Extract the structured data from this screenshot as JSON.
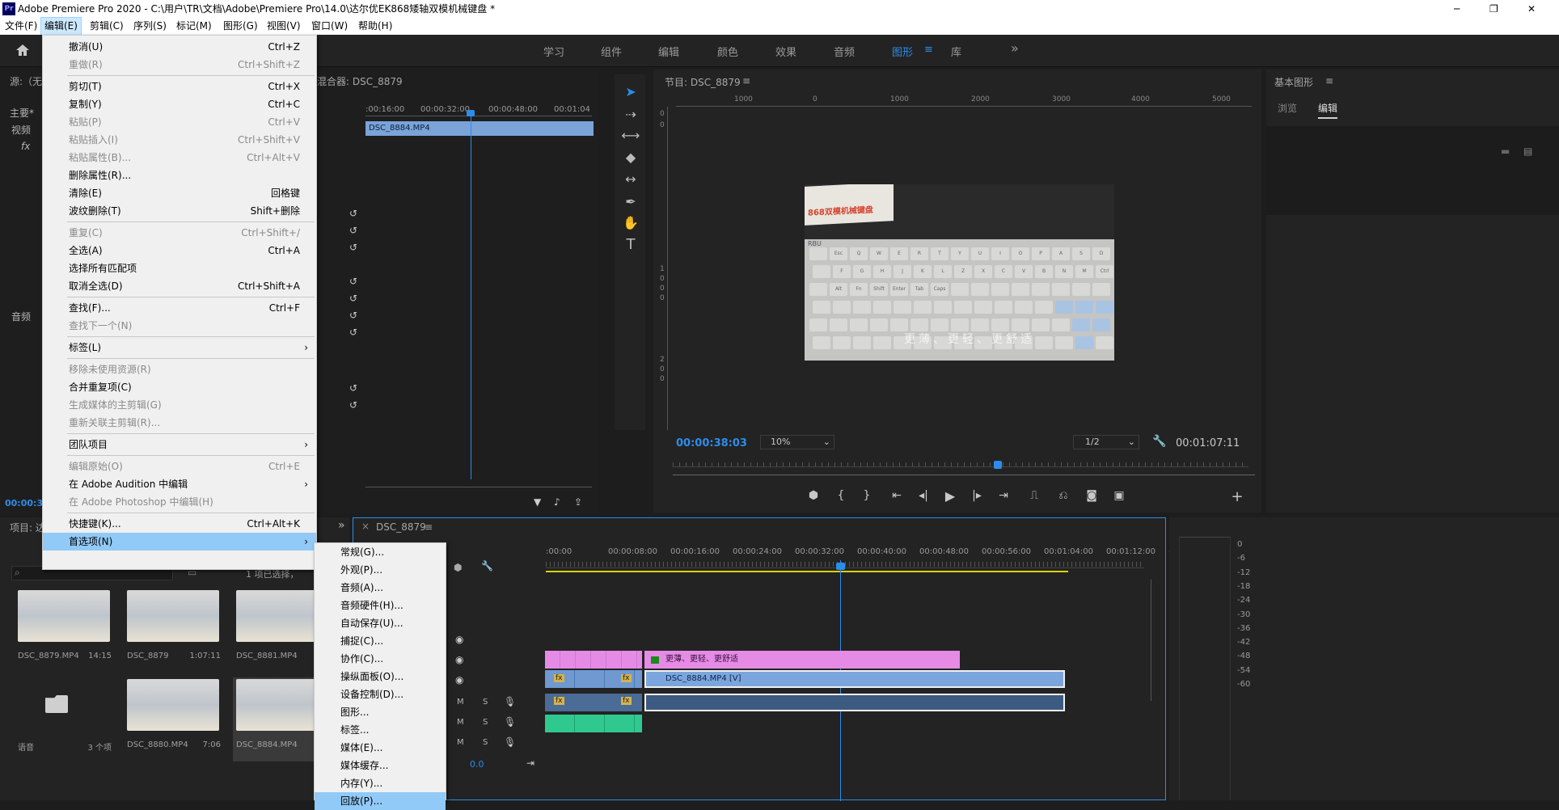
{
  "window": {
    "title": "Adobe Premiere Pro 2020 - C:\\用户\\TR\\文档\\Adobe\\Premiere Pro\\14.0\\达尔优EK868矮轴双模机械键盘 *",
    "app_icon": "Pr",
    "min": "─",
    "max": "❐",
    "close": "✕"
  },
  "menubar": [
    "文件(F)",
    "编辑(E)",
    "剪辑(C)",
    "序列(S)",
    "标记(M)",
    "图形(G)",
    "视图(V)",
    "窗口(W)",
    "帮助(H)"
  ],
  "workspaces": [
    "学习",
    "组件",
    "编辑",
    "颜色",
    "效果",
    "音频",
    "图形",
    "库"
  ],
  "workspace_more": "»",
  "edit_menu": [
    {
      "label": "撤消(U)",
      "shortcut": "Ctrl+Z",
      "disabled": false
    },
    {
      "label": "重做(R)",
      "shortcut": "Ctrl+Shift+Z",
      "disabled": true
    },
    {
      "sep": true
    },
    {
      "label": "剪切(T)",
      "shortcut": "Ctrl+X",
      "disabled": false
    },
    {
      "label": "复制(Y)",
      "shortcut": "Ctrl+C",
      "disabled": false
    },
    {
      "label": "粘贴(P)",
      "shortcut": "Ctrl+V",
      "disabled": true
    },
    {
      "label": "粘贴插入(I)",
      "shortcut": "Ctrl+Shift+V",
      "disabled": true
    },
    {
      "label": "粘贴属性(B)...",
      "shortcut": "Ctrl+Alt+V",
      "disabled": true
    },
    {
      "label": "删除属性(R)...",
      "shortcut": "",
      "disabled": false
    },
    {
      "label": "清除(E)",
      "shortcut": "回格键",
      "disabled": false
    },
    {
      "label": "波纹删除(T)",
      "shortcut": "Shift+删除",
      "disabled": false
    },
    {
      "sep": true
    },
    {
      "label": "重复(C)",
      "shortcut": "Ctrl+Shift+/",
      "disabled": true
    },
    {
      "label": "全选(A)",
      "shortcut": "Ctrl+A",
      "disabled": false
    },
    {
      "label": "选择所有匹配项",
      "shortcut": "",
      "disabled": false
    },
    {
      "label": "取消全选(D)",
      "shortcut": "Ctrl+Shift+A",
      "disabled": false
    },
    {
      "sep": true
    },
    {
      "label": "查找(F)...",
      "shortcut": "Ctrl+F",
      "disabled": false
    },
    {
      "label": "查找下一个(N)",
      "shortcut": "",
      "disabled": true
    },
    {
      "sep": true
    },
    {
      "label": "标签(L)",
      "shortcut": "",
      "disabled": false,
      "sub": true
    },
    {
      "sep": true
    },
    {
      "label": "移除未使用资源(R)",
      "shortcut": "",
      "disabled": true
    },
    {
      "label": "合并重复项(C)",
      "shortcut": "",
      "disabled": false
    },
    {
      "label": "生成媒体的主剪辑(G)",
      "shortcut": "",
      "disabled": true
    },
    {
      "label": "重新关联主剪辑(R)...",
      "shortcut": "",
      "disabled": true
    },
    {
      "sep": true
    },
    {
      "label": "团队项目",
      "shortcut": "",
      "disabled": false,
      "sub": true
    },
    {
      "sep": true
    },
    {
      "label": "编辑原始(O)",
      "shortcut": "Ctrl+E",
      "disabled": true
    },
    {
      "label": "在 Adobe Audition 中编辑",
      "shortcut": "",
      "disabled": false,
      "sub": true
    },
    {
      "label": "在 Adobe Photoshop 中编辑(H)",
      "shortcut": "",
      "disabled": true
    },
    {
      "sep": true
    },
    {
      "label": "快捷键(K)...",
      "shortcut": "Ctrl+Alt+K",
      "disabled": false
    },
    {
      "label": "首选项(N)",
      "shortcut": "",
      "disabled": false,
      "sub": true,
      "highlight": true
    }
  ],
  "pref_menu": [
    "常规(G)...",
    "外观(P)...",
    "音频(A)...",
    "音频硬件(H)...",
    "自动保存(U)...",
    "捕捉(C)...",
    "协作(C)...",
    "操纵面板(O)...",
    "设备控制(D)...",
    "图形...",
    "标签...",
    "媒体(E)...",
    "媒体缓存...",
    "内存(Y)...",
    "回放(P)..."
  ],
  "source_panel": {
    "title": "源:（无",
    "rows": [
      "主要*",
      "视频",
      "fx",
      "音频"
    ],
    "timecode": "00:00:38:"
  },
  "mixer_panel": {
    "title": "混合器: DSC_8879",
    "ruler": [
      ":00:16:00",
      "00:00:32:00",
      "00:00:48:00",
      "00:01:04"
    ],
    "clip": "DSC_8884.MP4"
  },
  "program": {
    "title": "节目: DSC_8879",
    "menu_icon": "≡",
    "timecode": "00:00:38:03",
    "zoom": "10%",
    "quality": "1/2",
    "duration": "00:01:07:11",
    "hruler": [
      "1000",
      "0",
      "1000",
      "2000",
      "3000",
      "4000",
      "5000"
    ],
    "vruler": [
      "0",
      "0",
      "1",
      "0",
      "0",
      "0",
      "2",
      "0",
      "0"
    ],
    "slogan": "更薄、更轻、更舒适",
    "brand": "868双模机械键盘",
    "kb_brand": "RBU",
    "keys": [
      "Esc",
      "Q",
      "W",
      "E",
      "R",
      "T",
      "Y",
      "U",
      "I",
      "O",
      "P",
      "A",
      "S",
      "D",
      "F",
      "G",
      "H",
      "J",
      "K",
      "L",
      "Z",
      "X",
      "C",
      "V",
      "B",
      "N",
      "M",
      "Ctrl",
      "Alt",
      "Fn",
      "Shift",
      "Enter",
      "Tab",
      "Caps"
    ]
  },
  "essential": {
    "title": "基本图形",
    "menu_icon": "≡",
    "tab_browse": "浏览",
    "tab_edit": "编辑"
  },
  "project": {
    "title": "项目: 达",
    "status": "1 项已选择，",
    "more": "»",
    "items": [
      {
        "name": "DSC_8879.MP4",
        "dur": "14:15"
      },
      {
        "name": "DSC_8879",
        "dur": "1:07:11"
      },
      {
        "name": "DSC_8881.MP4",
        "dur": ""
      },
      {
        "name": "语音",
        "dur": "3 个项"
      },
      {
        "name": "DSC_8880.MP4",
        "dur": "7:06"
      },
      {
        "name": "DSC_8884.MP4",
        "dur": "1:"
      }
    ]
  },
  "timeline": {
    "close": "×",
    "title": "DSC_8879",
    "menu_icon": "≡",
    "ruler": [
      ":00:00",
      "00:00:08:00",
      "00:00:16:00",
      "00:00:24:00",
      "00:00:32:00",
      "00:00:40:00",
      "00:00:48:00",
      "00:00:56:00",
      "00:01:04:00",
      "00:01:12:00",
      "("
    ],
    "graphic": "更薄、更轻、更舒适",
    "video_clip": "DSC_8884.MP4 [V]",
    "fx": "fx",
    "volume": "0.0",
    "track_m": "M",
    "track_s": "S"
  },
  "meter": {
    "scale": [
      "0",
      "-6",
      "-12",
      "-18",
      "-24",
      "-30",
      "-36",
      "-42",
      "-48",
      "-54",
      "-60"
    ]
  }
}
